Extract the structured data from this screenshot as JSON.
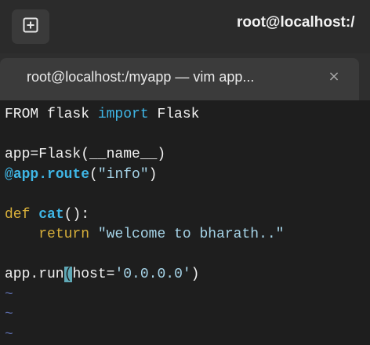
{
  "window": {
    "title": "root@localhost:/"
  },
  "tab": {
    "title": "root@localhost:/myapp — vim app...",
    "close_glyph": "×"
  },
  "icons": {
    "new_tab": "new-tab-icon",
    "close": "close-icon"
  },
  "code": {
    "l1_a": "FROM flask ",
    "l1_b": "import",
    "l1_c": " Flask",
    "l3": "app=Flask(__name__)",
    "l4_at": "@",
    "l4_fn": "app.route",
    "l4_p1": "(",
    "l4_str": "\"info\"",
    "l4_p2": ")",
    "l6_def": "def",
    "l6_sp": " ",
    "l6_fn": "cat",
    "l6_rest": "():",
    "l7_indent": "    ",
    "l7_kw": "return",
    "l7_sp": " ",
    "l7_str": "\"welcome to bharath..\"",
    "l9_a": "app.run",
    "l9_cursor": "(",
    "l9_b": "host=",
    "l9_str": "'0.0.0.0'",
    "l9_c": ")",
    "tilde": "~"
  },
  "colors": {
    "keyword": "#3fb6e6",
    "def_keyword": "#d7af3a",
    "string": "#a6d4e8",
    "cursor": "#5fa8b6",
    "tilde": "#5a6aa8"
  }
}
